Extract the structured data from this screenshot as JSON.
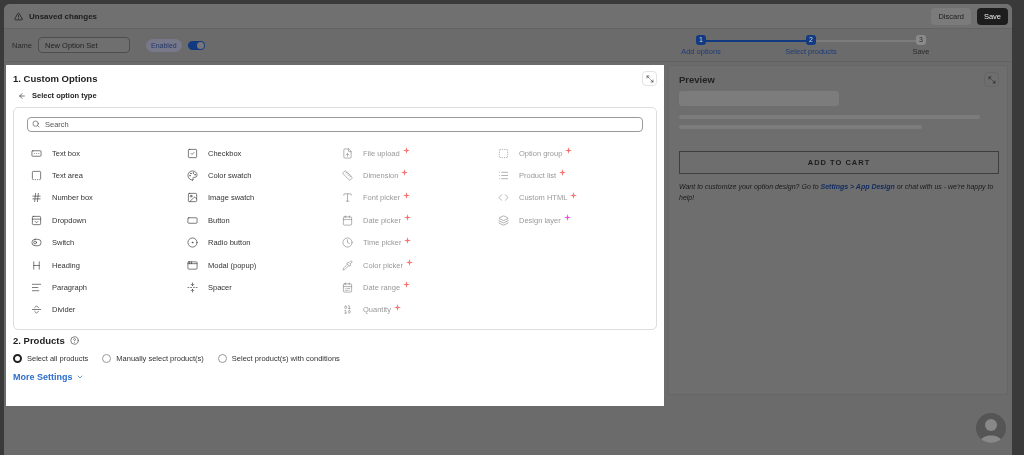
{
  "top_bar": {
    "title": "Unsaved changes",
    "buttons": [
      {
        "label": "Discard",
        "kind": "secondary"
      },
      {
        "label": "Save",
        "kind": "primary"
      }
    ]
  },
  "header": {
    "name_label": "Name",
    "name_placeholder": "New Option Set",
    "status_badge": "Enabled",
    "enabled": true,
    "steps": [
      {
        "number": "1",
        "label": "Add options",
        "completed": true
      },
      {
        "number": "2",
        "label": "Select products",
        "completed": true
      },
      {
        "number": "3",
        "label": "Save",
        "completed": false
      }
    ]
  },
  "custom_options": {
    "title": "1. Custom Options",
    "back_label": "Select option type",
    "search_placeholder": "Search",
    "option_columns": [
      [
        {
          "label": "Text box",
          "disabled": false
        },
        {
          "label": "Text area",
          "disabled": false
        },
        {
          "label": "Number box",
          "disabled": false
        },
        {
          "label": "Dropdown",
          "disabled": false
        },
        {
          "label": "Switch",
          "disabled": false
        },
        {
          "label": "Heading",
          "disabled": false
        },
        {
          "label": "Paragraph",
          "disabled": false
        },
        {
          "label": "Divider",
          "disabled": false
        }
      ],
      [
        {
          "label": "Checkbox",
          "disabled": false
        },
        {
          "label": "Color swatch",
          "disabled": false
        },
        {
          "label": "Image swatch",
          "disabled": false
        },
        {
          "label": "Button",
          "disabled": false
        },
        {
          "label": "Radio button",
          "disabled": false
        },
        {
          "label": "Modal (popup)",
          "disabled": false
        },
        {
          "label": "Spacer",
          "disabled": false
        }
      ],
      [
        {
          "label": "File upload",
          "disabled": true,
          "color": "#f87171"
        },
        {
          "label": "Dimension",
          "disabled": true,
          "color": "#f87171"
        },
        {
          "label": "Font picker",
          "disabled": true,
          "color": "#f87171"
        },
        {
          "label": "Date picker",
          "disabled": true,
          "color": "#f87171"
        },
        {
          "label": "Time picker",
          "disabled": true,
          "color": "#f87171"
        },
        {
          "label": "Color picker",
          "disabled": true,
          "color": "#f87171"
        },
        {
          "label": "Date range",
          "disabled": true,
          "color": "#f87171"
        },
        {
          "label": "Quantity",
          "disabled": true,
          "color": "#f87171"
        }
      ],
      [
        {
          "label": "Option group",
          "disabled": true,
          "color": "#f87171"
        },
        {
          "label": "Product list",
          "disabled": true,
          "color": "#f87171"
        },
        {
          "label": "Custom HTML",
          "disabled": true,
          "color": "#f87171"
        },
        {
          "label": "Design layer",
          "disabled": true,
          "color": "#e850e8"
        }
      ]
    ]
  },
  "products": {
    "title": "2. Products",
    "options": [
      {
        "label": "Select all products",
        "selected": true
      },
      {
        "label": "Manually select product(s)",
        "selected": false
      },
      {
        "label": "Select product(s) with conditions",
        "selected": false
      }
    ],
    "more_settings": "More Settings"
  },
  "preview": {
    "title": "Preview",
    "add_to_cart": "ADD TO CART",
    "help_text_before": "Want to customize your option design? Go to",
    "help_link": "Settings > App Design",
    "help_text_after": "or chat with us - we're happy to help!"
  }
}
